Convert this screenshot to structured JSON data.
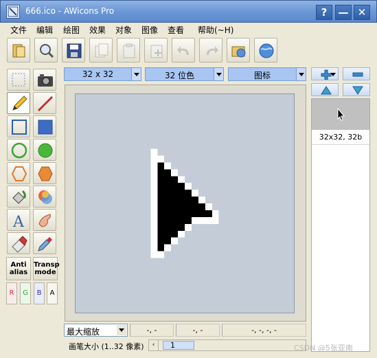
{
  "window": {
    "title": "666.ico - AWicons Pro",
    "help_label": "?",
    "min_label": "—",
    "close_label": "✕"
  },
  "menu": [
    "文件",
    "编辑",
    "绘图",
    "效果",
    "对象",
    "图像",
    "查看",
    "帮助(~H)"
  ],
  "options": {
    "size": "32 x 32",
    "depth": "32 位色",
    "type": "图标"
  },
  "tools_text": {
    "antialias": "Anti\nalias",
    "transparent": "Transp\nmode"
  },
  "channels": [
    "R",
    "G",
    "B",
    "A"
  ],
  "preview": {
    "label": "32x32, 32b"
  },
  "status": {
    "zoom": "最大缩放",
    "coord1": "-, -",
    "coord2": "-, -",
    "coord3": "-, -, -, -"
  },
  "brush": {
    "label": "画笔大小 (1..32 像素)",
    "value": "1"
  },
  "watermark": "CSDN @5张亚南",
  "colors": {
    "titlebar": "#6d98d6",
    "canvas_bg": "#c4cdd7",
    "select_bg": "#a9c6f2"
  }
}
